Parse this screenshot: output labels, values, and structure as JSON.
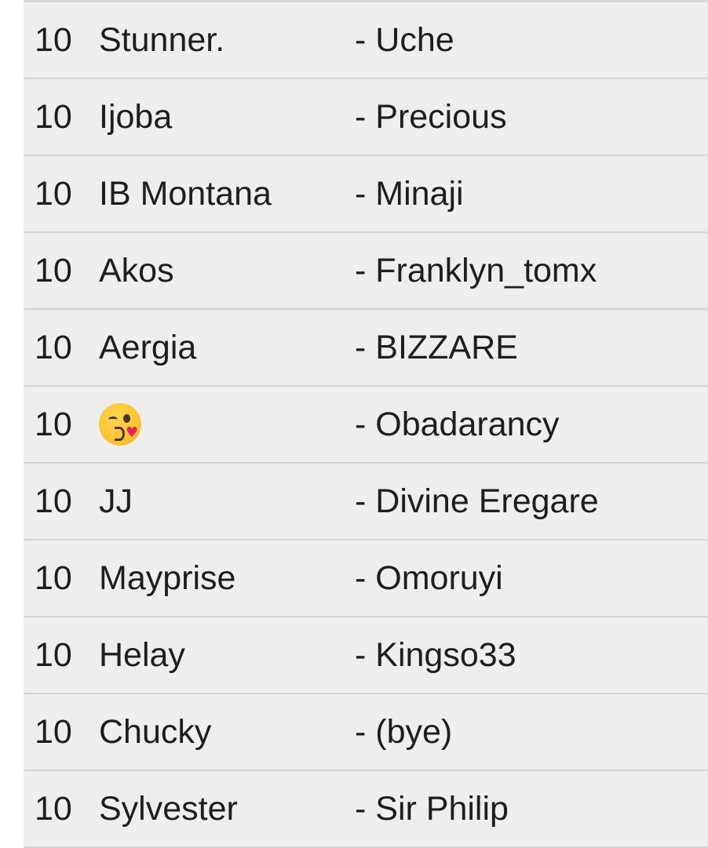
{
  "rows": [
    {
      "score": "10",
      "name": "Stunner.",
      "partner": "- Uche"
    },
    {
      "score": "10",
      "name": "Ijoba",
      "partner": "- Precious"
    },
    {
      "score": "10",
      "name": "IB Montana",
      "partner": "- Minaji"
    },
    {
      "score": "10",
      "name": "Akos",
      "partner": "- Franklyn_tomx"
    },
    {
      "score": "10",
      "name": "Aergia",
      "partner": "- BIZZARE"
    },
    {
      "score": "10",
      "name": "",
      "name_icon": "face-blowing-kiss-emoji",
      "partner": "- Obadarancy"
    },
    {
      "score": "10",
      "name": "JJ",
      "partner": "- Divine Eregare"
    },
    {
      "score": "10",
      "name": "Mayprise",
      "partner": "- Omoruyi"
    },
    {
      "score": "10",
      "name": "Helay",
      "partner": "- Kingso33"
    },
    {
      "score": "10",
      "name": "Chucky",
      "partner": "- (bye)"
    },
    {
      "score": "10",
      "name": "Sylvester",
      "partner": "- Sir Philip"
    }
  ],
  "colors": {
    "row_background": "#eeeeee",
    "divider": "#d3d3d3",
    "text": "#1e1e1e"
  }
}
